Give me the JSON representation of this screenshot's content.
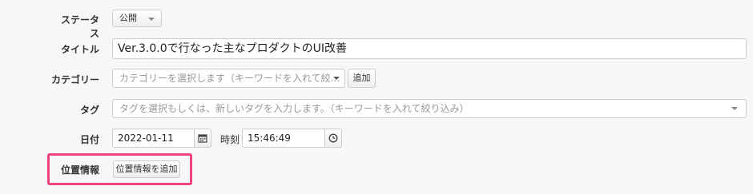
{
  "status": {
    "label": "ステータス",
    "value": "公開"
  },
  "title": {
    "label": "タイトル",
    "value": "Ver.3.0.0で行なった主なプロダクトのUI改善"
  },
  "category": {
    "label": "カテゴリー",
    "placeholder": "カテゴリーを選択します（キーワードを入れて絞…",
    "add_button": "追加"
  },
  "tag": {
    "label": "タグ",
    "placeholder": "タグを選択もしくは、新しいタグを入力します。（キーワードを入れて絞り込み）"
  },
  "date": {
    "label": "日付",
    "value": "2022-01-11",
    "time_label": "時刻",
    "time_value": "15:46:49"
  },
  "location": {
    "label": "位置情報",
    "add_button": "位置情報を追加"
  },
  "colors": {
    "highlight": "#f0437a"
  }
}
